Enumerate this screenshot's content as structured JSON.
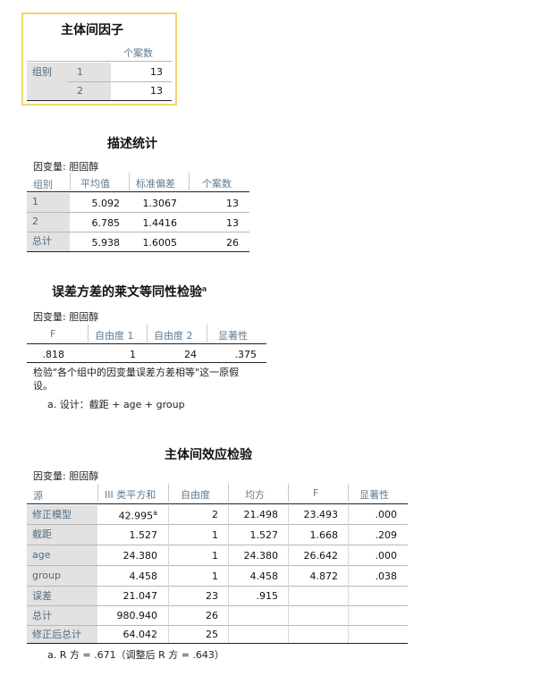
{
  "t1": {
    "title": "主体间因子",
    "col_header": "个案数",
    "row_group_label": "组别",
    "rows": [
      {
        "level": "1",
        "n": "13"
      },
      {
        "level": "2",
        "n": "13"
      }
    ]
  },
  "t2": {
    "title": "描述统计",
    "dep_var": "因变量:   胆固醇",
    "headers": [
      "组别",
      "平均值",
      "标准偏差",
      "个案数"
    ],
    "rows": [
      {
        "label": "1",
        "mean": "5.092",
        "sd": "1.3067",
        "n": "13"
      },
      {
        "label": "2",
        "mean": "6.785",
        "sd": "1.4416",
        "n": "13"
      },
      {
        "label": "总计",
        "mean": "5.938",
        "sd": "1.6005",
        "n": "26"
      }
    ]
  },
  "t3": {
    "title": "误差方差的莱文等同性检验",
    "title_sup": "a",
    "dep_var": "因变量:   胆固醇",
    "headers": [
      "F",
      "自由度 1",
      "自由度 2",
      "显著性"
    ],
    "row": {
      "f": ".818",
      "df1": "1",
      "df2": "24",
      "sig": ".375"
    },
    "note1": "检验\"各个组中的因变量误差方差相等\"这一原假",
    "note2": "设。",
    "footnote": "a. 设计：截距 + age + group"
  },
  "t4": {
    "title": "主体间效应检验",
    "dep_var": "因变量:   胆固醇",
    "headers": [
      "源",
      "III 类平方和",
      "自由度",
      "均方",
      "F",
      "显著性"
    ],
    "rows": [
      {
        "source": "修正模型",
        "ss": "42.995",
        "ss_sup": "a",
        "df": "2",
        "ms": "21.498",
        "f": "23.493",
        "sig": ".000"
      },
      {
        "source": "截距",
        "ss": "1.527",
        "ss_sup": "",
        "df": "1",
        "ms": "1.527",
        "f": "1.668",
        "sig": ".209"
      },
      {
        "source": "age",
        "ss": "24.380",
        "ss_sup": "",
        "df": "1",
        "ms": "24.380",
        "f": "26.642",
        "sig": ".000"
      },
      {
        "source": "group",
        "ss": "4.458",
        "ss_sup": "",
        "df": "1",
        "ms": "4.458",
        "f": "4.872",
        "sig": ".038"
      },
      {
        "source": "误差",
        "ss": "21.047",
        "ss_sup": "",
        "df": "23",
        "ms": ".915",
        "f": "",
        "sig": ""
      },
      {
        "source": "总计",
        "ss": "980.940",
        "ss_sup": "",
        "df": "26",
        "ms": "",
        "f": "",
        "sig": ""
      },
      {
        "source": "修正后总计",
        "ss": "64.042",
        "ss_sup": "",
        "df": "25",
        "ms": "",
        "f": "",
        "sig": ""
      }
    ],
    "footnote": "a. R 方 = .671（调整后 R 方 = .643）"
  },
  "colors": {
    "highlight_border": "#f2d272",
    "row_label_bg": "#e2e2e2",
    "header_text": "#5f7a8f"
  }
}
